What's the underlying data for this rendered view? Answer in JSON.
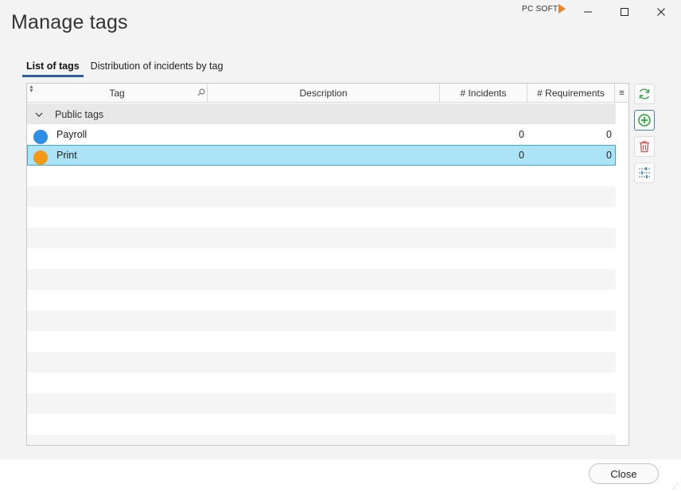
{
  "window": {
    "title": "Manage tags",
    "brand": "PC SOFT"
  },
  "tabs": [
    {
      "label": "List of tags",
      "active": true
    },
    {
      "label": "Distribution of incidents by tag",
      "active": false
    }
  ],
  "table": {
    "columns": [
      "Tag",
      "Description",
      "# Incidents",
      "# Requirements"
    ],
    "group_label": "Public tags",
    "rows": [
      {
        "name": "Payroll",
        "color": "#2d8ee6",
        "incidents": "0",
        "requirements": "0",
        "selected": false
      },
      {
        "name": "Print",
        "color": "#f29a17",
        "incidents": "0",
        "requirements": "0",
        "selected": true
      }
    ]
  },
  "side_tools": [
    "refresh-icon",
    "add-icon",
    "delete-icon",
    "settings-icon"
  ],
  "footer": {
    "close_label": "Close"
  },
  "colors": {
    "accent": "#2e5ea8",
    "selection": "#ade3f7"
  }
}
